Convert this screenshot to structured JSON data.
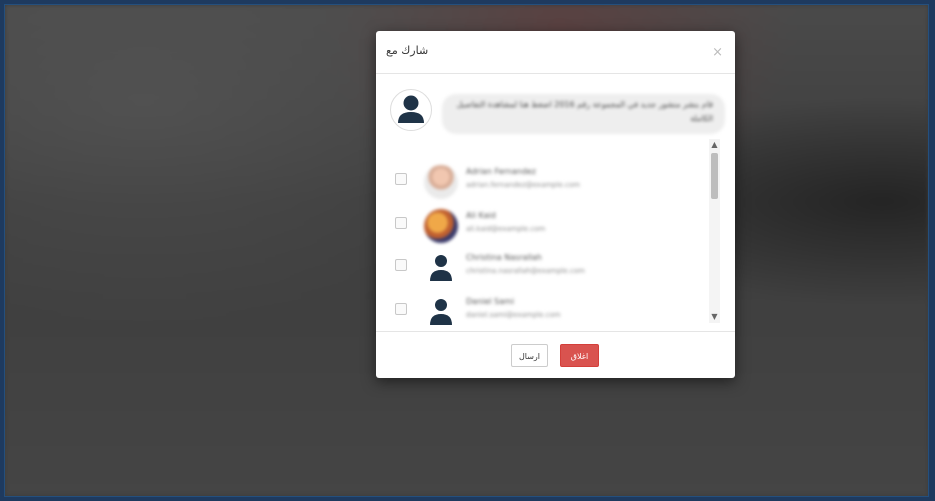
{
  "modal": {
    "title": "شارك مع",
    "close_symbol": "×",
    "post_text": "قام بنشر منشور جديد في المجموعة رقم 2016 اضغط هنا لمشاهدة التفاصيل الكاملة"
  },
  "users": [
    {
      "name": "Adrian Fernandez",
      "email": "adrian.fernandez@example.com",
      "avatar": "photo"
    },
    {
      "name": "Ali Kaid",
      "email": "ali.kaid@example.com",
      "avatar": "photo"
    },
    {
      "name": "Christina Nasrallah",
      "email": "christina.nasrallah@example.com",
      "avatar": "person-icon"
    },
    {
      "name": "Daniel Sami",
      "email": "daniel.sami@example.com",
      "avatar": "person-icon"
    }
  ],
  "scroll": {
    "up": "▲",
    "down": "▼"
  },
  "buttons": {
    "send": "ارسال",
    "close": "اغلاق"
  },
  "colors": {
    "close_button": "#d9534f",
    "avatar_icon": "#1f3347"
  }
}
